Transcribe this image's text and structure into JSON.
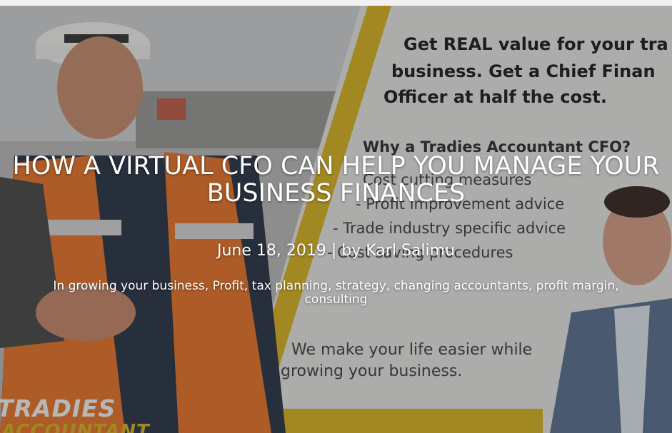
{
  "post": {
    "title": "HOW A VIRTUAL CFO CAN HELP YOU MANAGE YOUR BUSINESS FINANCES",
    "date": "June 18, 2019",
    "separator": " | ",
    "by_prefix": "by ",
    "author": "Karl Salimu",
    "categories_prefix": "In ",
    "categories": [
      "growing your business",
      "Profit",
      "tax planning",
      "strategy",
      "changing accountants",
      "profit margin",
      "consulting"
    ]
  },
  "hero_image": {
    "headline_line1": "Get REAL value for your tra",
    "headline_line2": "business.  Get a Chief Finan",
    "headline_line3": "Officer at half the cost.",
    "question": "Why a Tradies Accountant CFO?",
    "list": [
      "Cost cutting measures",
      "- Profit improvement advice",
      "- Trade industry specific advice",
      "- Cost saving procedures"
    ],
    "tagline_1": "We make your life easier while",
    "tagline_2": "growing your business.",
    "logo_line1": "TRADIES",
    "logo_line2": "ACCOUNTANT"
  },
  "colors": {
    "accent_yellow": "#d8b428",
    "vest_orange": "#e8772e",
    "overlay": "rgba(20,20,20,0.28)"
  }
}
